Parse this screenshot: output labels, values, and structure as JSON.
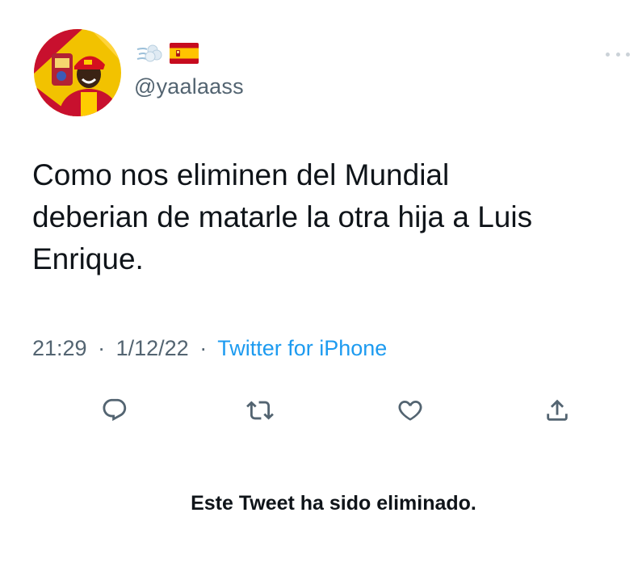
{
  "tweet": {
    "author": {
      "display_name_icons": [
        "dash-icon",
        "spain-flag-icon"
      ],
      "handle": "@yaalaass"
    },
    "text_lines": [
      "Como nos eliminen del Mundial",
      "deberian de matarle la otra hija a Luis",
      "Enrique."
    ],
    "time": "21:29",
    "date": "1/12/22",
    "separator": "·",
    "source": "Twitter for iPhone"
  },
  "actions": [
    "reply-icon",
    "retweet-icon",
    "like-icon",
    "share-icon"
  ],
  "notice": "Este Tweet ha sido eliminado.",
  "colors": {
    "text": "#0f1419",
    "secondary": "#536471",
    "link": "#1d9bf0",
    "flag_red": "#c60b1e",
    "flag_yellow": "#ffc400"
  }
}
